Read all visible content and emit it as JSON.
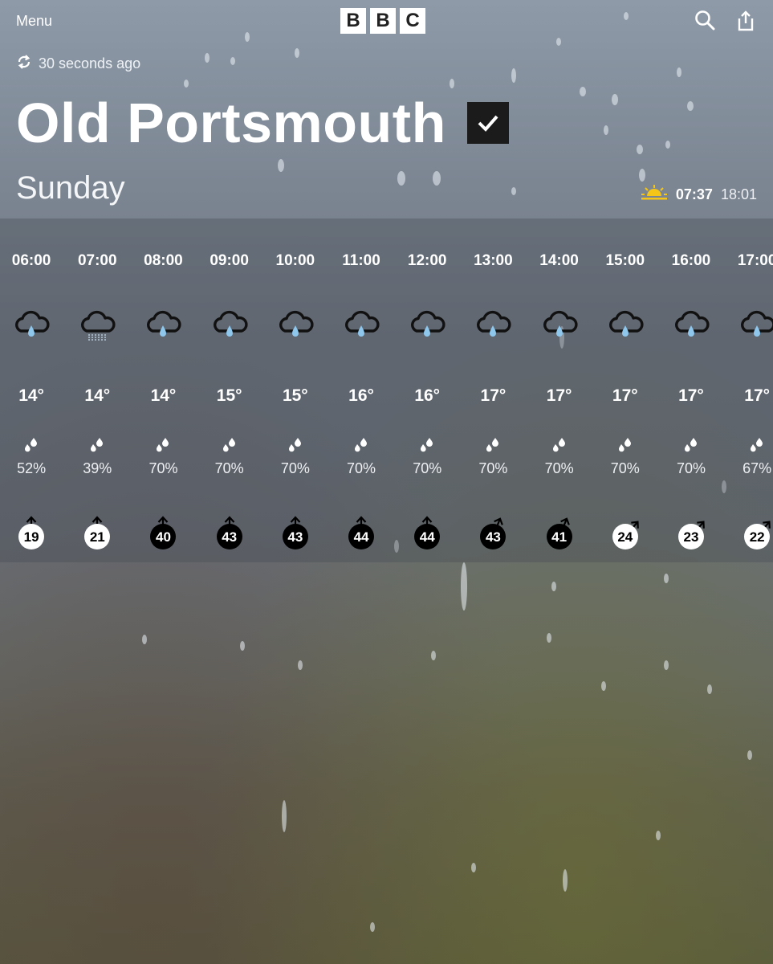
{
  "header": {
    "menu_label": "Menu",
    "brand_letters": [
      "B",
      "B",
      "C"
    ],
    "search_icon": "search-icon",
    "share_icon": "share-icon",
    "updated_text": "30 seconds ago",
    "location": "Old Portsmouth",
    "day": "Sunday",
    "sunrise": "07:37",
    "sunset": "18:01"
  },
  "colors": {
    "sun_accent": "#f5c518",
    "rain_drop": "#8ec6ec",
    "wind_dark_bg": "#000000",
    "wind_light_bg": "#ffffff"
  },
  "hourly": [
    {
      "time": "06:00",
      "icon": "light-rain-cloud",
      "temp": "14°",
      "chance": "52%",
      "wind": "19",
      "wind_style": "light",
      "wind_dir": "N"
    },
    {
      "time": "07:00",
      "icon": "drizzle-cloud",
      "temp": "14°",
      "chance": "39%",
      "wind": "21",
      "wind_style": "light",
      "wind_dir": "N"
    },
    {
      "time": "08:00",
      "icon": "light-rain-cloud",
      "temp": "14°",
      "chance": "70%",
      "wind": "40",
      "wind_style": "dark",
      "wind_dir": "N"
    },
    {
      "time": "09:00",
      "icon": "light-rain-cloud",
      "temp": "15°",
      "chance": "70%",
      "wind": "43",
      "wind_style": "dark",
      "wind_dir": "N"
    },
    {
      "time": "10:00",
      "icon": "light-rain-cloud",
      "temp": "15°",
      "chance": "70%",
      "wind": "43",
      "wind_style": "dark",
      "wind_dir": "N"
    },
    {
      "time": "11:00",
      "icon": "light-rain-cloud",
      "temp": "16°",
      "chance": "70%",
      "wind": "44",
      "wind_style": "dark",
      "wind_dir": "N"
    },
    {
      "time": "12:00",
      "icon": "light-rain-cloud",
      "temp": "16°",
      "chance": "70%",
      "wind": "44",
      "wind_style": "dark",
      "wind_dir": "N"
    },
    {
      "time": "13:00",
      "icon": "light-rain-cloud",
      "temp": "17°",
      "chance": "70%",
      "wind": "43",
      "wind_style": "dark",
      "wind_dir": "NNE"
    },
    {
      "time": "14:00",
      "icon": "light-rain-cloud",
      "temp": "17°",
      "chance": "70%",
      "wind": "41",
      "wind_style": "dark",
      "wind_dir": "NNE"
    },
    {
      "time": "15:00",
      "icon": "light-rain-cloud",
      "temp": "17°",
      "chance": "70%",
      "wind": "24",
      "wind_style": "light",
      "wind_dir": "NE"
    },
    {
      "time": "16:00",
      "icon": "light-rain-cloud",
      "temp": "17°",
      "chance": "70%",
      "wind": "23",
      "wind_style": "light",
      "wind_dir": "NE"
    },
    {
      "time": "17:00",
      "icon": "light-rain-cloud",
      "temp": "17°",
      "chance": "67%",
      "wind": "22",
      "wind_style": "light",
      "wind_dir": "NE"
    }
  ]
}
